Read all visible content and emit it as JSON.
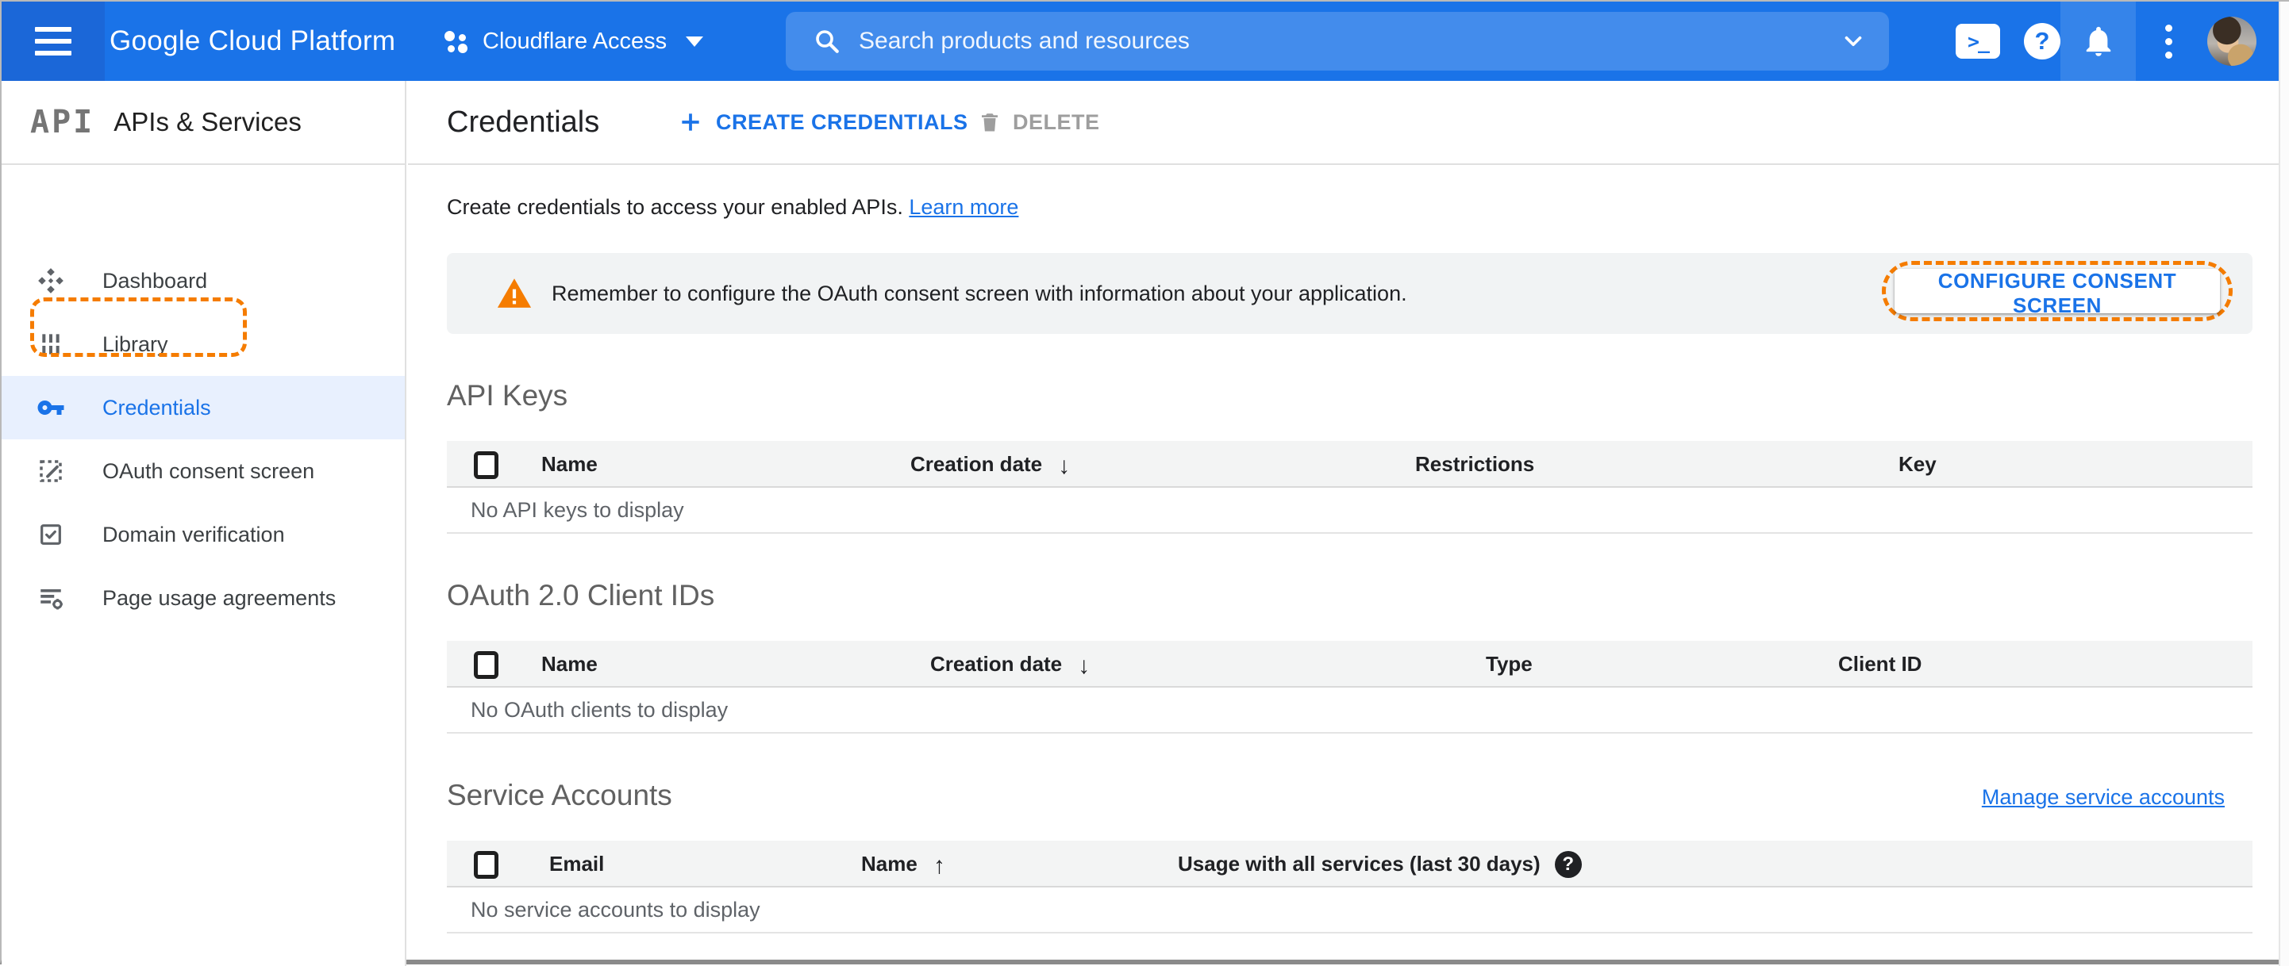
{
  "topbar": {
    "product": "Google Cloud Platform",
    "project": "Cloudflare Access",
    "search_placeholder": "Search products and resources",
    "shell_glyph": ">_",
    "help_glyph": "?"
  },
  "sidebar": {
    "logo": "API",
    "title": "APIs & Services",
    "items": [
      {
        "label": "Dashboard",
        "icon": "dashboard-icon",
        "selected": false
      },
      {
        "label": "Library",
        "icon": "library-icon",
        "selected": false
      },
      {
        "label": "Credentials",
        "icon": "key-icon",
        "selected": true
      },
      {
        "label": "OAuth consent screen",
        "icon": "consent-screen-icon",
        "selected": false
      },
      {
        "label": "Domain verification",
        "icon": "domain-verification-icon",
        "selected": false
      },
      {
        "label": "Page usage agreements",
        "icon": "page-usage-icon",
        "selected": false
      }
    ]
  },
  "header": {
    "title": "Credentials",
    "create_label": "CREATE CREDENTIALS",
    "delete_label": "DELETE"
  },
  "intro": {
    "text": "Create credentials to access your enabled APIs.",
    "link_label": "Learn more"
  },
  "banner": {
    "message": "Remember to configure the OAuth consent screen with information about your application.",
    "button_label": "CONFIGURE CONSENT SCREEN"
  },
  "sections": {
    "api_keys": {
      "title": "API Keys",
      "columns": [
        "Name",
        "Creation date",
        "Restrictions",
        "Key"
      ],
      "sort_column": "Creation date",
      "sort_arrow": "↓",
      "empty": "No API keys to display"
    },
    "oauth": {
      "title": "OAuth 2.0 Client IDs",
      "columns": [
        "Name",
        "Creation date",
        "Type",
        "Client ID"
      ],
      "sort_column": "Creation date",
      "sort_arrow": "↓",
      "empty": "No OAuth clients to display"
    },
    "service_accounts": {
      "title": "Service Accounts",
      "manage_link": "Manage service accounts",
      "columns": [
        "Email",
        "Name",
        "Usage with all services (last 30 days)"
      ],
      "sort_column": "Name",
      "sort_arrow": "↑",
      "help_glyph": "?",
      "empty": "No service accounts to display"
    }
  },
  "colors": {
    "topbar_blue": "#1a73e8",
    "link_blue": "#1a73e8",
    "highlight_orange": "#f57c00",
    "selected_item_bg": "#e8f0fe",
    "banner_bg": "#f1f3f4"
  }
}
